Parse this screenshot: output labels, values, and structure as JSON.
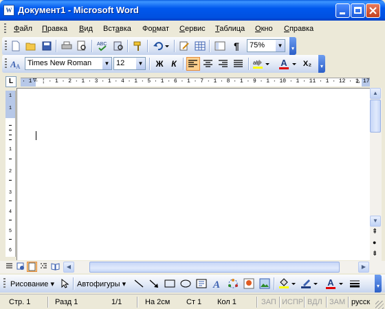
{
  "window": {
    "title": "Документ1 - Microsoft Word",
    "icon_letter": "W"
  },
  "colors": {
    "titlebar": "#0058EE",
    "close_button": "#c3401e",
    "active_view": "#fdd08e"
  },
  "menu": {
    "items": [
      {
        "pre": "",
        "u": "Ф",
        "post": "айл"
      },
      {
        "pre": "",
        "u": "П",
        "post": "равка"
      },
      {
        "pre": "",
        "u": "В",
        "post": "ид"
      },
      {
        "pre": "Вст",
        "u": "а",
        "post": "вка"
      },
      {
        "pre": "Фо",
        "u": "р",
        "post": "мат"
      },
      {
        "pre": "",
        "u": "С",
        "post": "ервис"
      },
      {
        "pre": "",
        "u": "Т",
        "post": "аблица"
      },
      {
        "pre": "",
        "u": "О",
        "post": "кно"
      },
      {
        "pre": "",
        "u": "С",
        "post": "правка"
      }
    ]
  },
  "standard_toolbar": {
    "zoom": "75%"
  },
  "format_toolbar": {
    "font_name": "Times New Roman",
    "font_size": "12",
    "bold": "Ж",
    "italic": "К",
    "font_color_letter": "A",
    "subscript": "X₂"
  },
  "ruler": {
    "horizontal": "· 1 · ¦ · 1 · 2 · 1 · 3 · 1 · 4 · 1 · 5 · 1 · 6 · 1 · 7 · 1 · 8 · 1 · 9 · 1 · 10 · 1 · 11 · 1 · 12 · 1 · 13 · 1 · 14 · 1 · 15 · 1 · 16 ·",
    "corner_17": "17",
    "vertical": [
      "1",
      "1",
      "1",
      "2",
      "3",
      "4",
      "5",
      "6"
    ]
  },
  "drawing_toolbar": {
    "draw_label": "Рисование",
    "autoshapes_label": "Автофигуры"
  },
  "status": {
    "page": "Стр. 1",
    "section": "Разд 1",
    "pages": "1/1",
    "at": "На 2см",
    "line": "Ст 1",
    "col": "Кол 1",
    "rec": "ЗАП",
    "trk": "ИСПР",
    "ext": "ВДЛ",
    "ovr": "ЗАМ",
    "lang": "русск"
  }
}
